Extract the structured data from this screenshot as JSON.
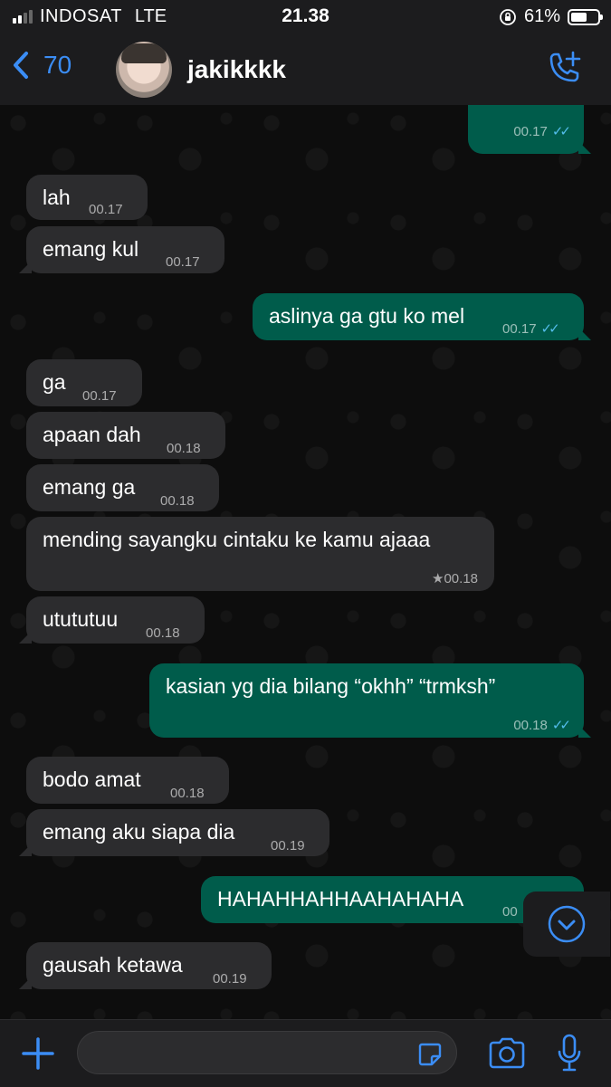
{
  "status_bar": {
    "carrier": "INDOSAT",
    "network": "LTE",
    "time": "21.38",
    "battery": "61%",
    "battery_level": 0.61,
    "icons": [
      "signal-icon",
      "orientation-lock-icon",
      "battery-icon"
    ]
  },
  "header": {
    "back_count": "70",
    "contact_name": "jakikkkk",
    "icons": [
      "chevron-left-icon",
      "avatar",
      "add-call-icon"
    ]
  },
  "messages": [
    {
      "dir": "out",
      "text": "",
      "time": "00.17",
      "read": true
    },
    {
      "dir": "in",
      "text": "lah",
      "time": "00.17"
    },
    {
      "dir": "in",
      "text": "emang kul",
      "time": "00.17"
    },
    {
      "dir": "out",
      "text": "aslinya ga gtu ko mel",
      "time": "00.17",
      "read": true
    },
    {
      "dir": "in",
      "text": "ga",
      "time": "00.17"
    },
    {
      "dir": "in",
      "text": "apaan dah",
      "time": "00.18"
    },
    {
      "dir": "in",
      "text": "emang ga",
      "time": "00.18"
    },
    {
      "dir": "in",
      "text": "mending sayangku cintaku ke kamu ajaaa",
      "time": "★00.18",
      "starred": true
    },
    {
      "dir": "in",
      "text": "utututuu",
      "time": "00.18"
    },
    {
      "dir": "out",
      "text": "kasian yg dia bilang “okhh” “trmksh”",
      "time": "00.18",
      "read": true
    },
    {
      "dir": "in",
      "text": "bodo amat",
      "time": "00.18"
    },
    {
      "dir": "in",
      "text": "emang aku siapa dia",
      "time": "00.19"
    },
    {
      "dir": "out",
      "text": "HAHAHHAHHAAHAHAHA",
      "time": "00",
      "read": true
    },
    {
      "dir": "in",
      "text": "gausah ketawa",
      "time": "00.19"
    }
  ],
  "read_ticks": "✓✓",
  "input_bar": {
    "placeholder": "",
    "icons": [
      "plus-icon",
      "sticker-icon",
      "camera-icon",
      "microphone-icon",
      "scroll-down-icon"
    ]
  },
  "colors": {
    "accent": "#3b8df5",
    "incoming_bubble": "#2c2c2e",
    "outgoing_bubble": "#005c4b",
    "read_ticks": "#53bdeb"
  }
}
